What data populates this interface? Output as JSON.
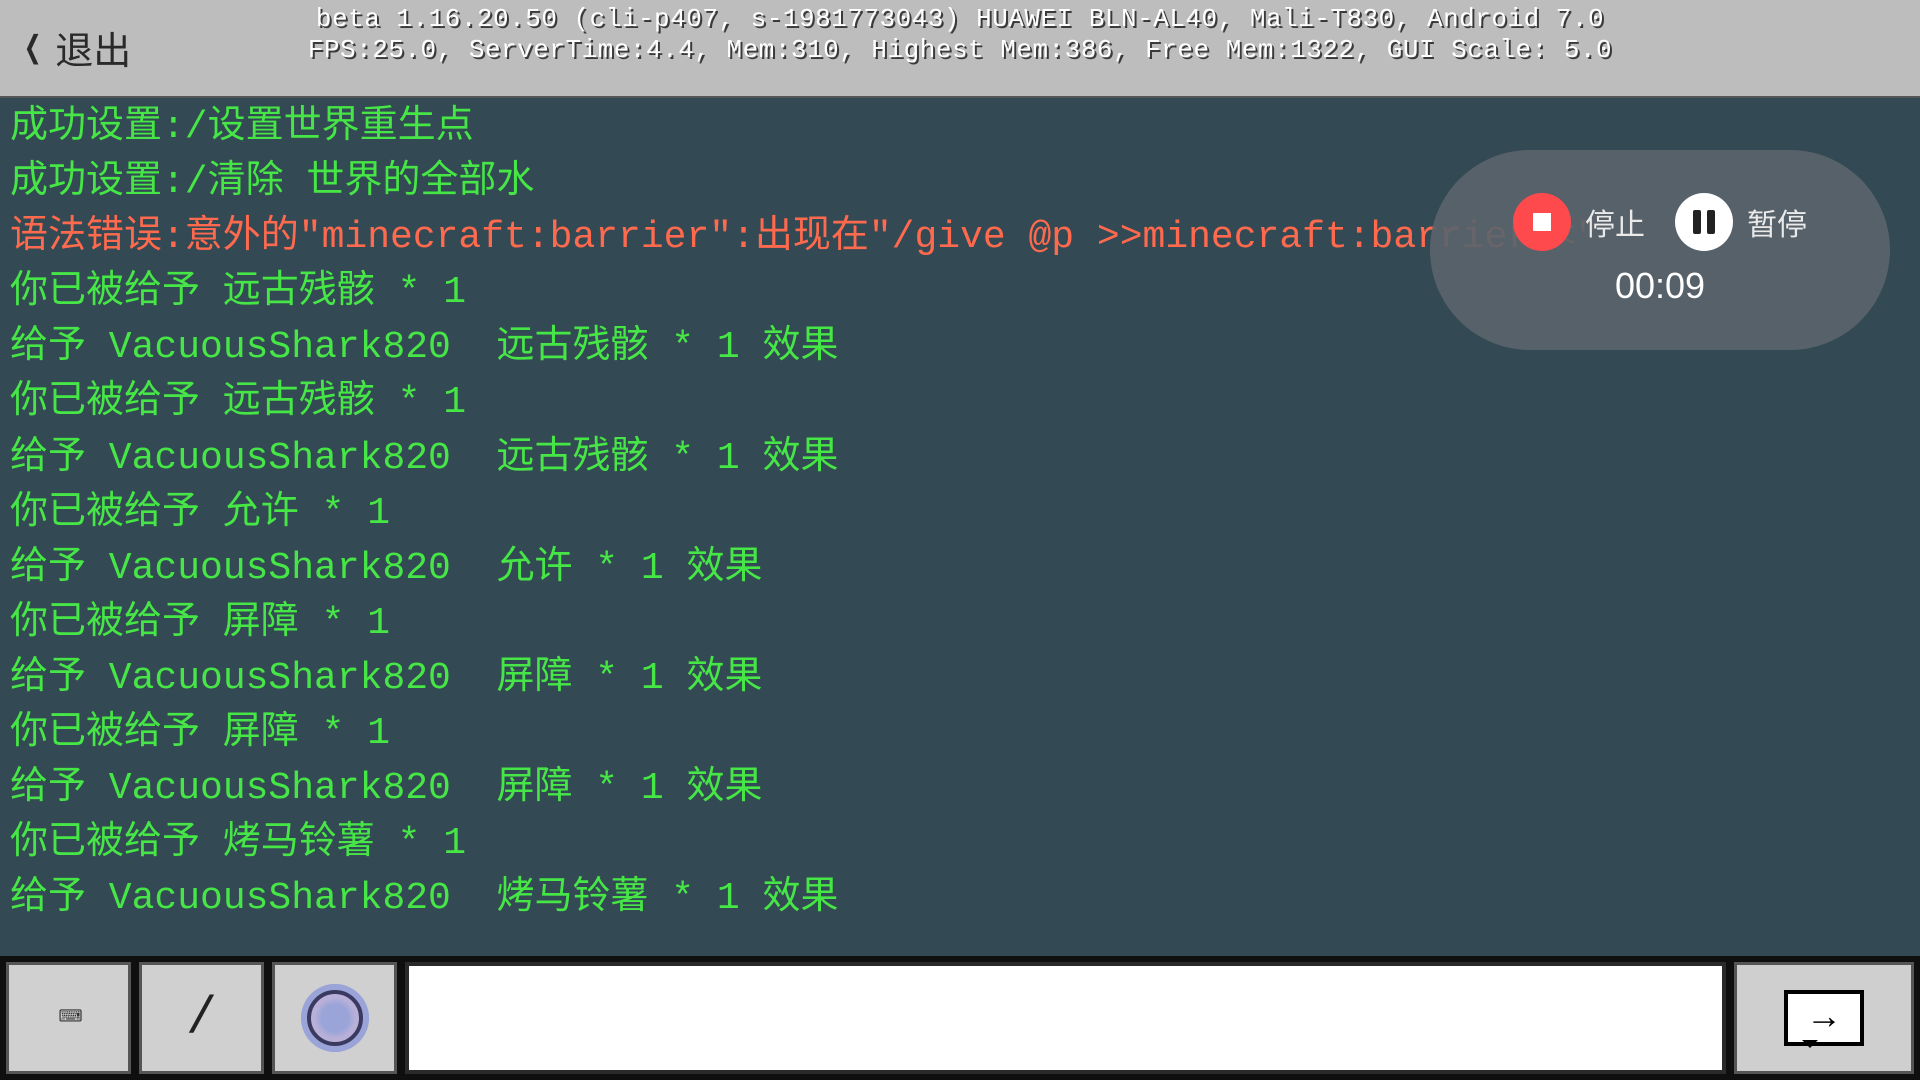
{
  "header": {
    "exit_label": "退出",
    "debug_line1": "beta 1.16.20.50 (cli-p407, s-1981773043) HUAWEI BLN-AL40, Mali-T830, Android 7.0",
    "debug_line2": "FPS:25.0, ServerTime:4.4, Mem:310, Highest Mem:386, Free Mem:1322, GUI Scale: 5.0"
  },
  "chat_lines": [
    {
      "text": "成功设置:/设置世界重生点",
      "color": "c-green"
    },
    {
      "text": "成功设置:/清除 世界的全部水",
      "color": "c-green"
    },
    {
      "text": "语法错误:意外的\"minecraft:barrier\":出现在\"/give @p >>minecraft:barrier<<\"",
      "color": "c-red"
    },
    {
      "text": "你已被给予 远古残骸 * 1",
      "color": "c-green"
    },
    {
      "text": "给予 VacuousShark820  远古残骸 * 1 效果",
      "color": "c-green"
    },
    {
      "text": "你已被给予 远古残骸 * 1",
      "color": "c-green"
    },
    {
      "text": "给予 VacuousShark820  远古残骸 * 1 效果",
      "color": "c-green"
    },
    {
      "text": "你已被给予 允许 * 1",
      "color": "c-green"
    },
    {
      "text": "给予 VacuousShark820  允许 * 1 效果",
      "color": "c-green"
    },
    {
      "text": "你已被给予 屏障 * 1",
      "color": "c-green"
    },
    {
      "text": "给予 VacuousShark820  屏障 * 1 效果",
      "color": "c-green"
    },
    {
      "text": "你已被给予 屏障 * 1",
      "color": "c-green"
    },
    {
      "text": "给予 VacuousShark820  屏障 * 1 效果",
      "color": "c-green"
    },
    {
      "text": "你已被给予 烤马铃薯 * 1",
      "color": "c-green"
    },
    {
      "text": "给予 VacuousShark820  烤马铃薯 * 1 效果",
      "color": "c-green"
    }
  ],
  "recorder": {
    "stop_label": "停止",
    "pause_label": "暂停",
    "elapsed": "00:09"
  },
  "bottom": {
    "slash_label": "/",
    "input_value": ""
  }
}
